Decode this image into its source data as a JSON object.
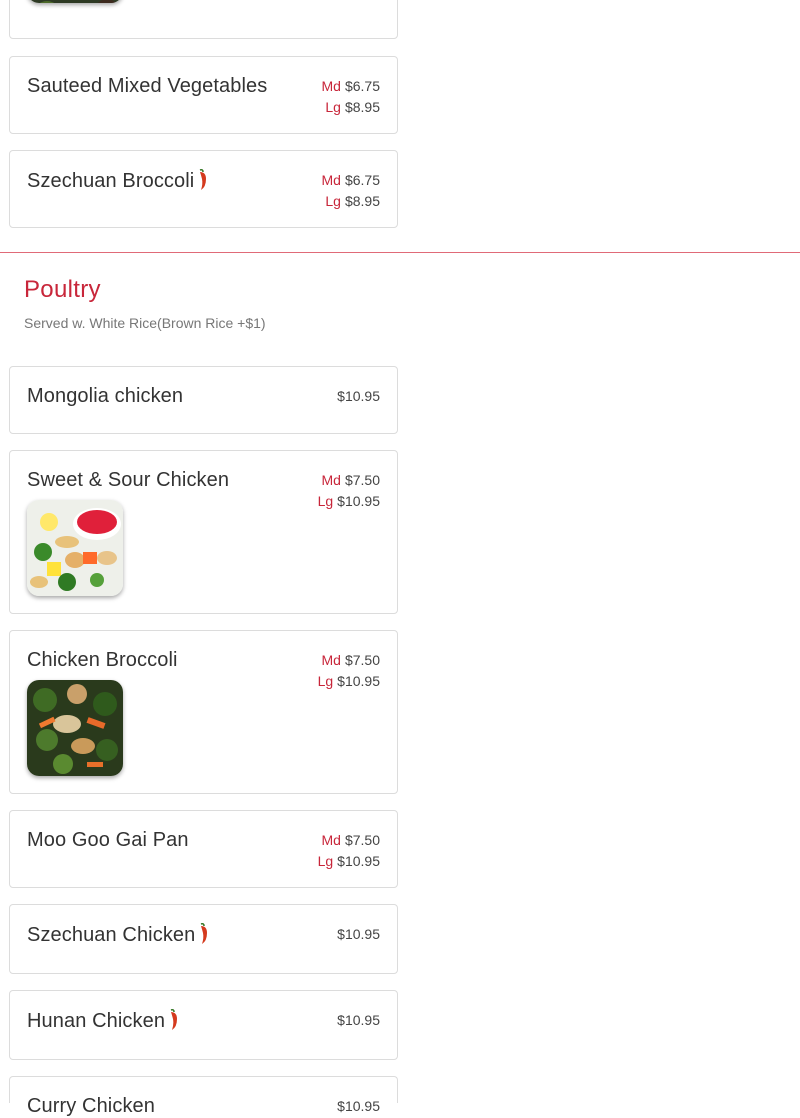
{
  "top_items": [
    {
      "name": "Sauteed Mixed Vegetables",
      "spicy": false,
      "prices": [
        {
          "size": "Md",
          "price": "$6.75"
        },
        {
          "size": "Lg",
          "price": "$8.95"
        }
      ]
    },
    {
      "name": "Szechuan Broccoli",
      "spicy": true,
      "prices": [
        {
          "size": "Md",
          "price": "$6.75"
        },
        {
          "size": "Lg",
          "price": "$8.95"
        }
      ]
    }
  ],
  "section": {
    "title": "Poultry",
    "subtitle": "Served w. White Rice(Brown Rice +$1)"
  },
  "items": [
    {
      "name": "Mongolia chicken",
      "spicy": false,
      "prices": [
        {
          "size": "",
          "price": "$10.95"
        }
      ]
    },
    {
      "name": "Sweet & Sour Chicken",
      "spicy": false,
      "has_image": true,
      "prices": [
        {
          "size": "Md",
          "price": "$7.50"
        },
        {
          "size": "Lg",
          "price": "$10.95"
        }
      ]
    },
    {
      "name": "Chicken Broccoli",
      "spicy": false,
      "has_image": true,
      "prices": [
        {
          "size": "Md",
          "price": "$7.50"
        },
        {
          "size": "Lg",
          "price": "$10.95"
        }
      ]
    },
    {
      "name": "Moo Goo Gai Pan",
      "spicy": false,
      "prices": [
        {
          "size": "Md",
          "price": "$7.50"
        },
        {
          "size": "Lg",
          "price": "$10.95"
        }
      ]
    },
    {
      "name": "Szechuan Chicken",
      "spicy": true,
      "prices": [
        {
          "size": "",
          "price": "$10.95"
        }
      ]
    },
    {
      "name": "Hunan Chicken",
      "spicy": true,
      "prices": [
        {
          "size": "",
          "price": "$10.95"
        }
      ]
    },
    {
      "name": "Curry Chicken",
      "spicy": false,
      "prices": [
        {
          "size": "",
          "price": "$10.95"
        }
      ]
    }
  ],
  "colors": {
    "accent": "#c8263a",
    "divider": "#e06a78",
    "border": "#dcdcdc",
    "text": "#333333",
    "muted": "#777777"
  },
  "icons": {
    "spicy": "chili-pepper-icon"
  }
}
